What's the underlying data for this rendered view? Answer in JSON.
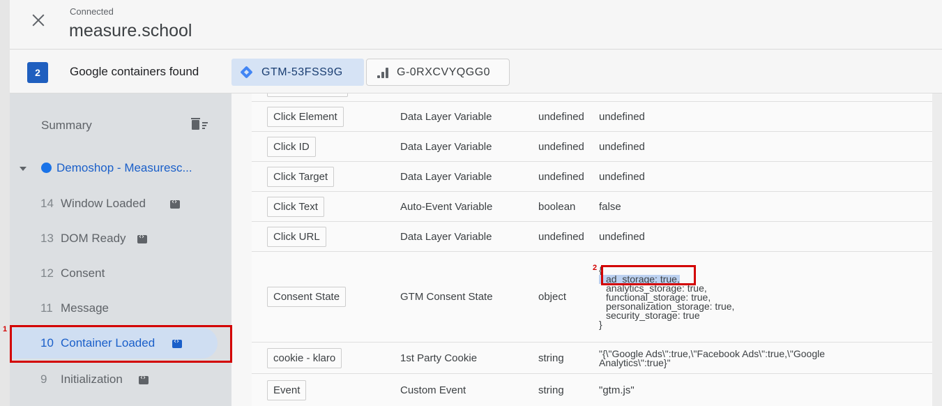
{
  "header": {
    "status": "Connected",
    "domain": "measure.school"
  },
  "containers": {
    "count": "2",
    "label": "Google containers found",
    "gtm_id": "GTM-53FSS9G",
    "ga_id": "G-0RXCVYQGG0"
  },
  "sidebar": {
    "summary_label": "Summary",
    "page_title": "Demoshop - Measuresc...",
    "events": [
      {
        "num": "14",
        "name": "Window Loaded",
        "tag": true
      },
      {
        "num": "13",
        "name": "DOM Ready",
        "tag": true
      },
      {
        "num": "12",
        "name": "Consent",
        "tag": false
      },
      {
        "num": "11",
        "name": "Message",
        "tag": false
      },
      {
        "num": "10",
        "name": "Container Loaded",
        "tag": true,
        "selected": true
      },
      {
        "num": "9",
        "name": "Initialization",
        "tag": true
      }
    ]
  },
  "variables": [
    {
      "name": "Click Element",
      "type": "Data Layer Variable",
      "dtype": "undefined",
      "value": "undefined"
    },
    {
      "name": "Click ID",
      "type": "Data Layer Variable",
      "dtype": "undefined",
      "value": "undefined"
    },
    {
      "name": "Click Target",
      "type": "Data Layer Variable",
      "dtype": "undefined",
      "value": "undefined"
    },
    {
      "name": "Click Text",
      "type": "Auto-Event Variable",
      "dtype": "boolean",
      "value": "false"
    },
    {
      "name": "Click URL",
      "type": "Data Layer Variable",
      "dtype": "undefined",
      "value": "undefined"
    },
    {
      "name": "Consent State",
      "type": "GTM Consent State",
      "dtype": "object",
      "value_lines": [
        "{",
        "ad_storage: true,",
        "analytics_storage: true,",
        "functional_storage: true,",
        "personalization_storage: true,",
        "security_storage: true",
        "}"
      ]
    },
    {
      "name": "cookie - klaro",
      "type": "1st Party Cookie",
      "dtype": "string",
      "value_lines": [
        "\"{\\\"Google Ads\\\":true,\\\"Facebook Ads\\\":true,\\\"Google",
        "Analytics\\\":true}\""
      ]
    },
    {
      "name": "Event",
      "type": "Custom Event",
      "dtype": "string",
      "value": "\"gtm.js\""
    }
  ],
  "annotations": {
    "marker_1": "1",
    "marker_2": "2"
  }
}
